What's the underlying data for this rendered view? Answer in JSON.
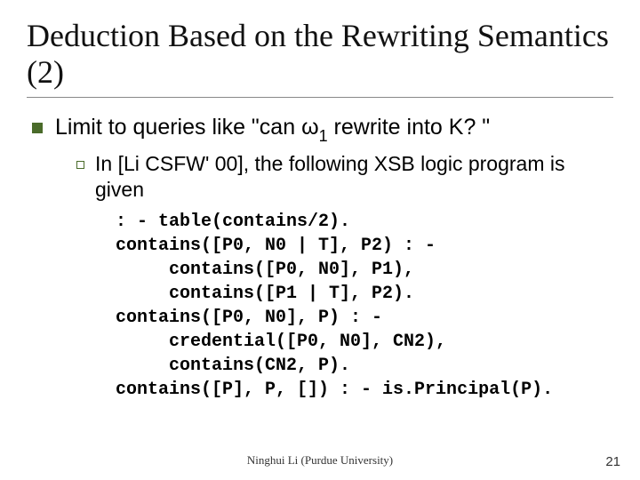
{
  "title": "Deduction Based on the Rewriting Semantics (2)",
  "bullet1_pre": "Limit to queries like \"can ",
  "bullet1_omega": "ω",
  "bullet1_sub": "1",
  "bullet1_post": " rewrite into K? \"",
  "bullet2": "In [Li CSFW' 00], the following XSB logic program is given",
  "code": ": - table(contains/2).\ncontains([P0, N0 | T], P2) : -\n     contains([P0, N0], P1),\n     contains([P1 | T], P2).\ncontains([P0, N0], P) : -\n     credential([P0, N0], CN2),\n     contains(CN2, P).\ncontains([P], P, []) : - is.Principal(P).",
  "footer_center": "Ninghui Li (Purdue University)",
  "footer_page": "21"
}
